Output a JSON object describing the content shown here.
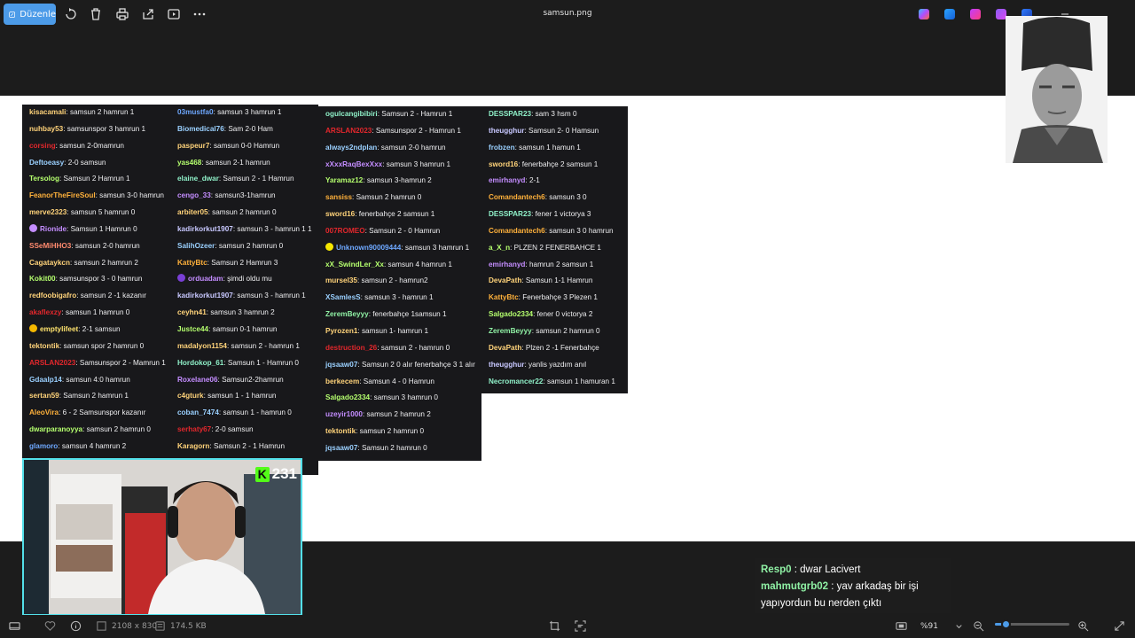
{
  "titlebar": {
    "edit_label": "Düzenle",
    "title": "samsun.png",
    "icons": [
      "rotate-icon",
      "delete-icon",
      "print-icon",
      "share-icon",
      "slideshow-icon",
      "more-icon"
    ],
    "app_icons": [
      "copilot-icon",
      "paint-icon",
      "clipchamp-icon",
      "designer-icon",
      "edge-icon"
    ]
  },
  "chat_columns": [
    {
      "messages": [
        {
          "user": "kisacamali",
          "color": "#ffd37a",
          "text": ": samsun 2 hamrun 1"
        },
        {
          "user": "nuhbay53",
          "color": "#ffd37a",
          "text": ": samsunspor 3 hamrun 1"
        },
        {
          "user": "corsing",
          "color": "#e1272c",
          "text": ": samsun 2-0mamrun"
        },
        {
          "user": "Deftoeasy",
          "color": "#9ad0ff",
          "text": ": 2-0 samsun"
        },
        {
          "user": "Tersolog",
          "color": "#b5ff6e",
          "text": ": Samsun 2 Hamrun 1"
        },
        {
          "user": "FeanorTheFireSoul",
          "color": "#ffb13b",
          "text": ": samsun 3-0 hamrun"
        },
        {
          "user": "merve2323",
          "color": "#ffd37a",
          "text": ": samsun 5 hamrun 0"
        },
        {
          "user": "Rionide",
          "color": "#c48dff",
          "text": ": Samsun 1 Hamrun 0",
          "badge": "#c48dff"
        },
        {
          "user": "SSeMiHHO3",
          "color": "#ff8a6e",
          "text": ": samsun 2-0 hamrun"
        },
        {
          "user": "Cagataykcn",
          "color": "#ffd37a",
          "text": ": samsun 2 hamrun 2"
        },
        {
          "user": "Kokit00",
          "color": "#b5ff6e",
          "text": ": samsunspor 3 - 0 hamrun"
        },
        {
          "user": "redfoobigafro",
          "color": "#ffd37a",
          "text": ": samsun 2 -1 kazanır"
        },
        {
          "user": "akaflexzy",
          "color": "#e1272c",
          "text": ": samsun 1 hamrun 0"
        },
        {
          "user": "emptylifeet",
          "color": "#ffe36e",
          "text": ": 2-1 samsun",
          "badge": "#f5b800"
        },
        {
          "user": "tektontik",
          "color": "#ffd37a",
          "text": ": samsun spor 2 hamrun 0"
        },
        {
          "user": "ARSLAN2023",
          "color": "#e1272c",
          "text": ": Samsunspor 2 - Mamrun 1"
        },
        {
          "user": "Gdaalp14",
          "color": "#9ad0ff",
          "text": ": samsun 4:0 hamrun"
        },
        {
          "user": "sertan59",
          "color": "#ffd37a",
          "text": ": Samsun 2 hamrun 1"
        },
        {
          "user": "AleoVira",
          "color": "#ffb13b",
          "text": ": 6 - 2 Samsunspor kazanır"
        },
        {
          "user": "dwarparanoyya",
          "color": "#b5ff6e",
          "text": ": samsun 2 hamrun 0"
        },
        {
          "user": "glamoro",
          "color": "#6ea8ff",
          "text": ": samsun 4 hamrun 2"
        }
      ]
    },
    {
      "messages": [
        {
          "user": "03mustfa0",
          "color": "#6ea8ff",
          "text": ": samsun 3 hamrun 1"
        },
        {
          "user": "Biomedical76",
          "color": "#9ad0ff",
          "text": ": Sam 2-0 Ham"
        },
        {
          "user": "paspeur7",
          "color": "#ffd37a",
          "text": ": samsun 0-0 Hamrun"
        },
        {
          "user": "yas468",
          "color": "#b5ff6e",
          "text": ": samsun 2-1 hamrun"
        },
        {
          "user": "elaine_dwar",
          "color": "#8ff0c8",
          "text": ": Samsun 2 - 1 Hamrun"
        },
        {
          "user": "cengo_33",
          "color": "#c48dff",
          "text": ": samsun3-1hamrun"
        },
        {
          "user": "arbiter05",
          "color": "#ffd37a",
          "text": ": samsun 2 hamrun 0"
        },
        {
          "user": "kadirkorkut1907",
          "color": "#c8c8ff",
          "text": ": samsun 3 - hamrun 1 1"
        },
        {
          "user": "SalihOzeer",
          "color": "#9ad0ff",
          "text": ": samsun 2 hamrun 0"
        },
        {
          "user": "KattyBtc",
          "color": "#ffb13b",
          "text": ": Samsun 2 Hamrun 3"
        },
        {
          "user": "orduadam",
          "color": "#c48dff",
          "text": ": şimdi oldu mu",
          "badge": "#7a3fd6"
        },
        {
          "user": "kadirkorkut1907",
          "color": "#c8c8ff",
          "text": ": samsun 3 - hamrun 1"
        },
        {
          "user": "ceyhn41",
          "color": "#ffd37a",
          "text": ": samsun 3 hamrun 2"
        },
        {
          "user": "Justce44",
          "color": "#b5ff6e",
          "text": ": samsun 0-1 hamrun"
        },
        {
          "user": "madalyon1154",
          "color": "#ffd37a",
          "text": ": samsun 2 - hamrun 1"
        },
        {
          "user": "Hordokop_61",
          "color": "#8ff0c8",
          "text": ": Samsun 1 - Hamrun 0"
        },
        {
          "user": "Roxelane06",
          "color": "#c48dff",
          "text": ": Samsun2-2hamrun"
        },
        {
          "user": "c4gturk",
          "color": "#ffd37a",
          "text": ": samsun 1 - 1 hamrun"
        },
        {
          "user": "coban_7474",
          "color": "#9ad0ff",
          "text": ": samsun 1 - hamrun 0"
        },
        {
          "user": "serhaty67",
          "color": "#e1272c",
          "text": ": 2-0 samsun"
        },
        {
          "user": "Karagorn",
          "color": "#ffd37a",
          "text": ": Samsun 2 - 1 Hamrun"
        }
      ]
    },
    {
      "messages": [
        {
          "user": "ogulcangibibiri",
          "color": "#8ff0c8",
          "text": ": Samsun 2 - Hamrun 1"
        },
        {
          "user": "ARSLAN2023",
          "color": "#e1272c",
          "text": ": Samsunspor 2 - Hamrun 1"
        },
        {
          "user": "always2ndplan",
          "color": "#9ad0ff",
          "text": ": samsun 2-0 hamrun"
        },
        {
          "user": "xXxxRaqBexXxx",
          "color": "#c48dff",
          "text": ": samsun 3 hamrun 1"
        },
        {
          "user": "Yaramaz12",
          "color": "#b5ff6e",
          "text": ": samsun 3-hamrun 2"
        },
        {
          "user": "sansiss",
          "color": "#ffb13b",
          "text": ": Samsun 2 hamrun 0"
        },
        {
          "user": "sword16",
          "color": "#ffd37a",
          "text": ": fenerbahçe 2 samsun 1"
        },
        {
          "user": "007ROMEO",
          "color": "#e1272c",
          "text": ": Samsun 2 - 0 Hamrun"
        },
        {
          "user": "Unknown90009444",
          "color": "#6ea8ff",
          "text": ": samsun 3 hamrun 1",
          "badge": "#f5e600"
        },
        {
          "user": "xX_SwindLer_Xx",
          "color": "#b5ff6e",
          "text": ": samsun 4 hamrun 1"
        },
        {
          "user": "mursel35",
          "color": "#ffd37a",
          "text": ": samsun 2 - hamrun2"
        },
        {
          "user": "XSamlesS",
          "color": "#9ad0ff",
          "text": ": samsun 3 - hamrun 1"
        },
        {
          "user": "ZeremBeyyy",
          "color": "#8ff0a4",
          "text": ": fenerbahçe 1samsun 1"
        },
        {
          "user": "Pyrozen1",
          "color": "#ffd37a",
          "text": ": samsun 1- hamrun 1"
        },
        {
          "user": "destruction_26",
          "color": "#e1272c",
          "text": ": samsun 2 - hamrun 0"
        },
        {
          "user": "jqsaaw07",
          "color": "#9ad0ff",
          "text": ": Samsun 2 0 alır fenerbahçe 3 1 alır"
        },
        {
          "user": "berkecem",
          "color": "#ffd37a",
          "text": ": Samsun 4 - 0 Hamrun"
        },
        {
          "user": "Salgado2334",
          "color": "#b5ff6e",
          "text": ": samsun 3 hamrun 0"
        },
        {
          "user": "uzeyir1000",
          "color": "#c48dff",
          "text": ": samsun 2 hamrun 2"
        },
        {
          "user": "tektontik",
          "color": "#ffd37a",
          "text": ": samsun 2 hamrun 0"
        },
        {
          "user": "jqsaaw07",
          "color": "#9ad0ff",
          "text": ": Samsun 2 hamrun 0"
        }
      ]
    },
    {
      "messages": [
        {
          "user": "DESSPAR23",
          "color": "#8ff0c8",
          "text": ": sam 3 hsm 0"
        },
        {
          "user": "theugghur",
          "color": "#c8c8ff",
          "text": ": Samsun 2- 0 Hamsun"
        },
        {
          "user": "frobzen",
          "color": "#9ad0ff",
          "text": ": samsun 1 hamun 1"
        },
        {
          "user": "sword16",
          "color": "#ffd37a",
          "text": ": fenerbahçe 2 samsun 1"
        },
        {
          "user": "emirhanyd",
          "color": "#c48dff",
          "text": ": 2-1"
        },
        {
          "user": "Comandantech6",
          "color": "#ffb13b",
          "text": ": samsun 3 0"
        },
        {
          "user": "DESSPAR23",
          "color": "#8ff0c8",
          "text": ": fener 1 victorya 3"
        },
        {
          "user": "Comandantech6",
          "color": "#ffb13b",
          "text": ": samsun 3 0 hamrun"
        },
        {
          "user": "a_X_n",
          "color": "#b5ff6e",
          "text": ": PLZEN 2 FENERBAHCE 1"
        },
        {
          "user": "emirhanyd",
          "color": "#c48dff",
          "text": ": hamrun 2 samsun 1"
        },
        {
          "user": "DevaPath",
          "color": "#ffd37a",
          "text": ": Samsun 1-1 Hamrun"
        },
        {
          "user": "KattyBtc",
          "color": "#ffb13b",
          "text": ": Fenerbahçe 3 Plezen 1"
        },
        {
          "user": "Salgado2334",
          "color": "#b5ff6e",
          "text": ": fener 0 victorya 2"
        },
        {
          "user": "ZeremBeyyy",
          "color": "#8ff0a4",
          "text": ": samsun 2 hamrun 0"
        },
        {
          "user": "DevaPath",
          "color": "#ffd37a",
          "text": ": Plzen 2 -1 Fenerbahçe"
        },
        {
          "user": "theugghur",
          "color": "#c8c8ff",
          "text": ": yanlis yazdım anıl"
        },
        {
          "user": "Necromancer22",
          "color": "#8ff0c8",
          "text": ": samsun 1 hamuran 1"
        }
      ]
    }
  ],
  "webcam": {
    "platform_badge": "K",
    "viewer_count": "231"
  },
  "overlay_chat": [
    {
      "user": "Resp0",
      "text": " : dwar Lacivert"
    },
    {
      "user": "mahmutgrb02",
      "text": " : yav arkadaş bir işi"
    },
    {
      "user": "",
      "text": "yapıyordun bu nerden çıktı"
    }
  ],
  "statusbar": {
    "dimensions": "2108 x 830",
    "file_size": "174.5 KB",
    "zoom_label": "%91",
    "zoom_level": 0.14
  },
  "colors": {
    "accent": "#4c9be8",
    "chat_bg": "#18181b",
    "webcam_border": "#53e0ea",
    "kick_green": "#53fc18"
  }
}
